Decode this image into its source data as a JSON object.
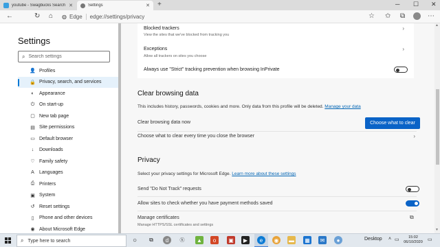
{
  "tabs": [
    {
      "title": "youtube - Swagbucks Search",
      "close": "✕"
    },
    {
      "title": "Settings",
      "close": "✕"
    }
  ],
  "new_tab": "+",
  "address": {
    "site": "Edge",
    "path": "edge://settings/privacy"
  },
  "settings_title": "Settings",
  "search_placeholder": "Search settings",
  "nav": [
    {
      "label": "Profiles",
      "icon": "person-icon",
      "glyph": "👤"
    },
    {
      "label": "Privacy, search, and services",
      "icon": "lock-icon",
      "glyph": "🔒"
    },
    {
      "label": "Appearance",
      "icon": "palette-icon",
      "glyph": "◐"
    },
    {
      "label": "On start-up",
      "icon": "power-icon",
      "glyph": "⏻"
    },
    {
      "label": "New tab page",
      "icon": "newtab-icon",
      "glyph": "▢"
    },
    {
      "label": "Site permissions",
      "icon": "permissions-icon",
      "glyph": "▤"
    },
    {
      "label": "Default browser",
      "icon": "browser-icon",
      "glyph": "▭"
    },
    {
      "label": "Downloads",
      "icon": "download-icon",
      "glyph": "↓"
    },
    {
      "label": "Family safety",
      "icon": "family-icon",
      "glyph": "♡"
    },
    {
      "label": "Languages",
      "icon": "language-icon",
      "glyph": "A"
    },
    {
      "label": "Printers",
      "icon": "printer-icon",
      "glyph": "⎙"
    },
    {
      "label": "System",
      "icon": "system-icon",
      "glyph": "▣"
    },
    {
      "label": "Reset settings",
      "icon": "reset-icon",
      "glyph": "↺"
    },
    {
      "label": "Phone and other devices",
      "icon": "phone-icon",
      "glyph": "▯"
    },
    {
      "label": "About Microsoft Edge",
      "icon": "edge-icon",
      "glyph": "◉"
    }
  ],
  "active_nav": "Privacy, search, and services",
  "tracking": {
    "blocked_title": "Blocked trackers",
    "blocked_sub": "View the sites that we've blocked from tracking you",
    "exceptions_title": "Exceptions",
    "exceptions_sub": "Allow all trackers on sites you choose",
    "strict_label": "Always use \"Strict\" tracking prevention when browsing InPrivate",
    "strict_on": false
  },
  "clear": {
    "heading": "Clear browsing data",
    "description": "This includes history, passwords, cookies and more. Only data from this profile will be deleted.",
    "manage_link": "Manage your data",
    "now_label": "Clear browsing data now",
    "choose_button": "Choose what to clear",
    "every_time_label": "Choose what to clear every time you close the browser"
  },
  "privacy": {
    "heading": "Privacy",
    "description": "Select your privacy settings for Microsoft Edge.",
    "learn_link": "Learn more about these settings",
    "dnt_label": "Send \"Do Not Track\" requests",
    "dnt_on": false,
    "payment_label": "Allow sites to check whether you have payment methods saved",
    "payment_on": true,
    "certs_title": "Manage certificates",
    "certs_sub": "Manage HTTPS/SSL certificates and settings"
  },
  "taskbar": {
    "search_placeholder": "Type here to search",
    "desktop_label": "Desktop",
    "time": "15:02",
    "date": "06/10/2020"
  }
}
